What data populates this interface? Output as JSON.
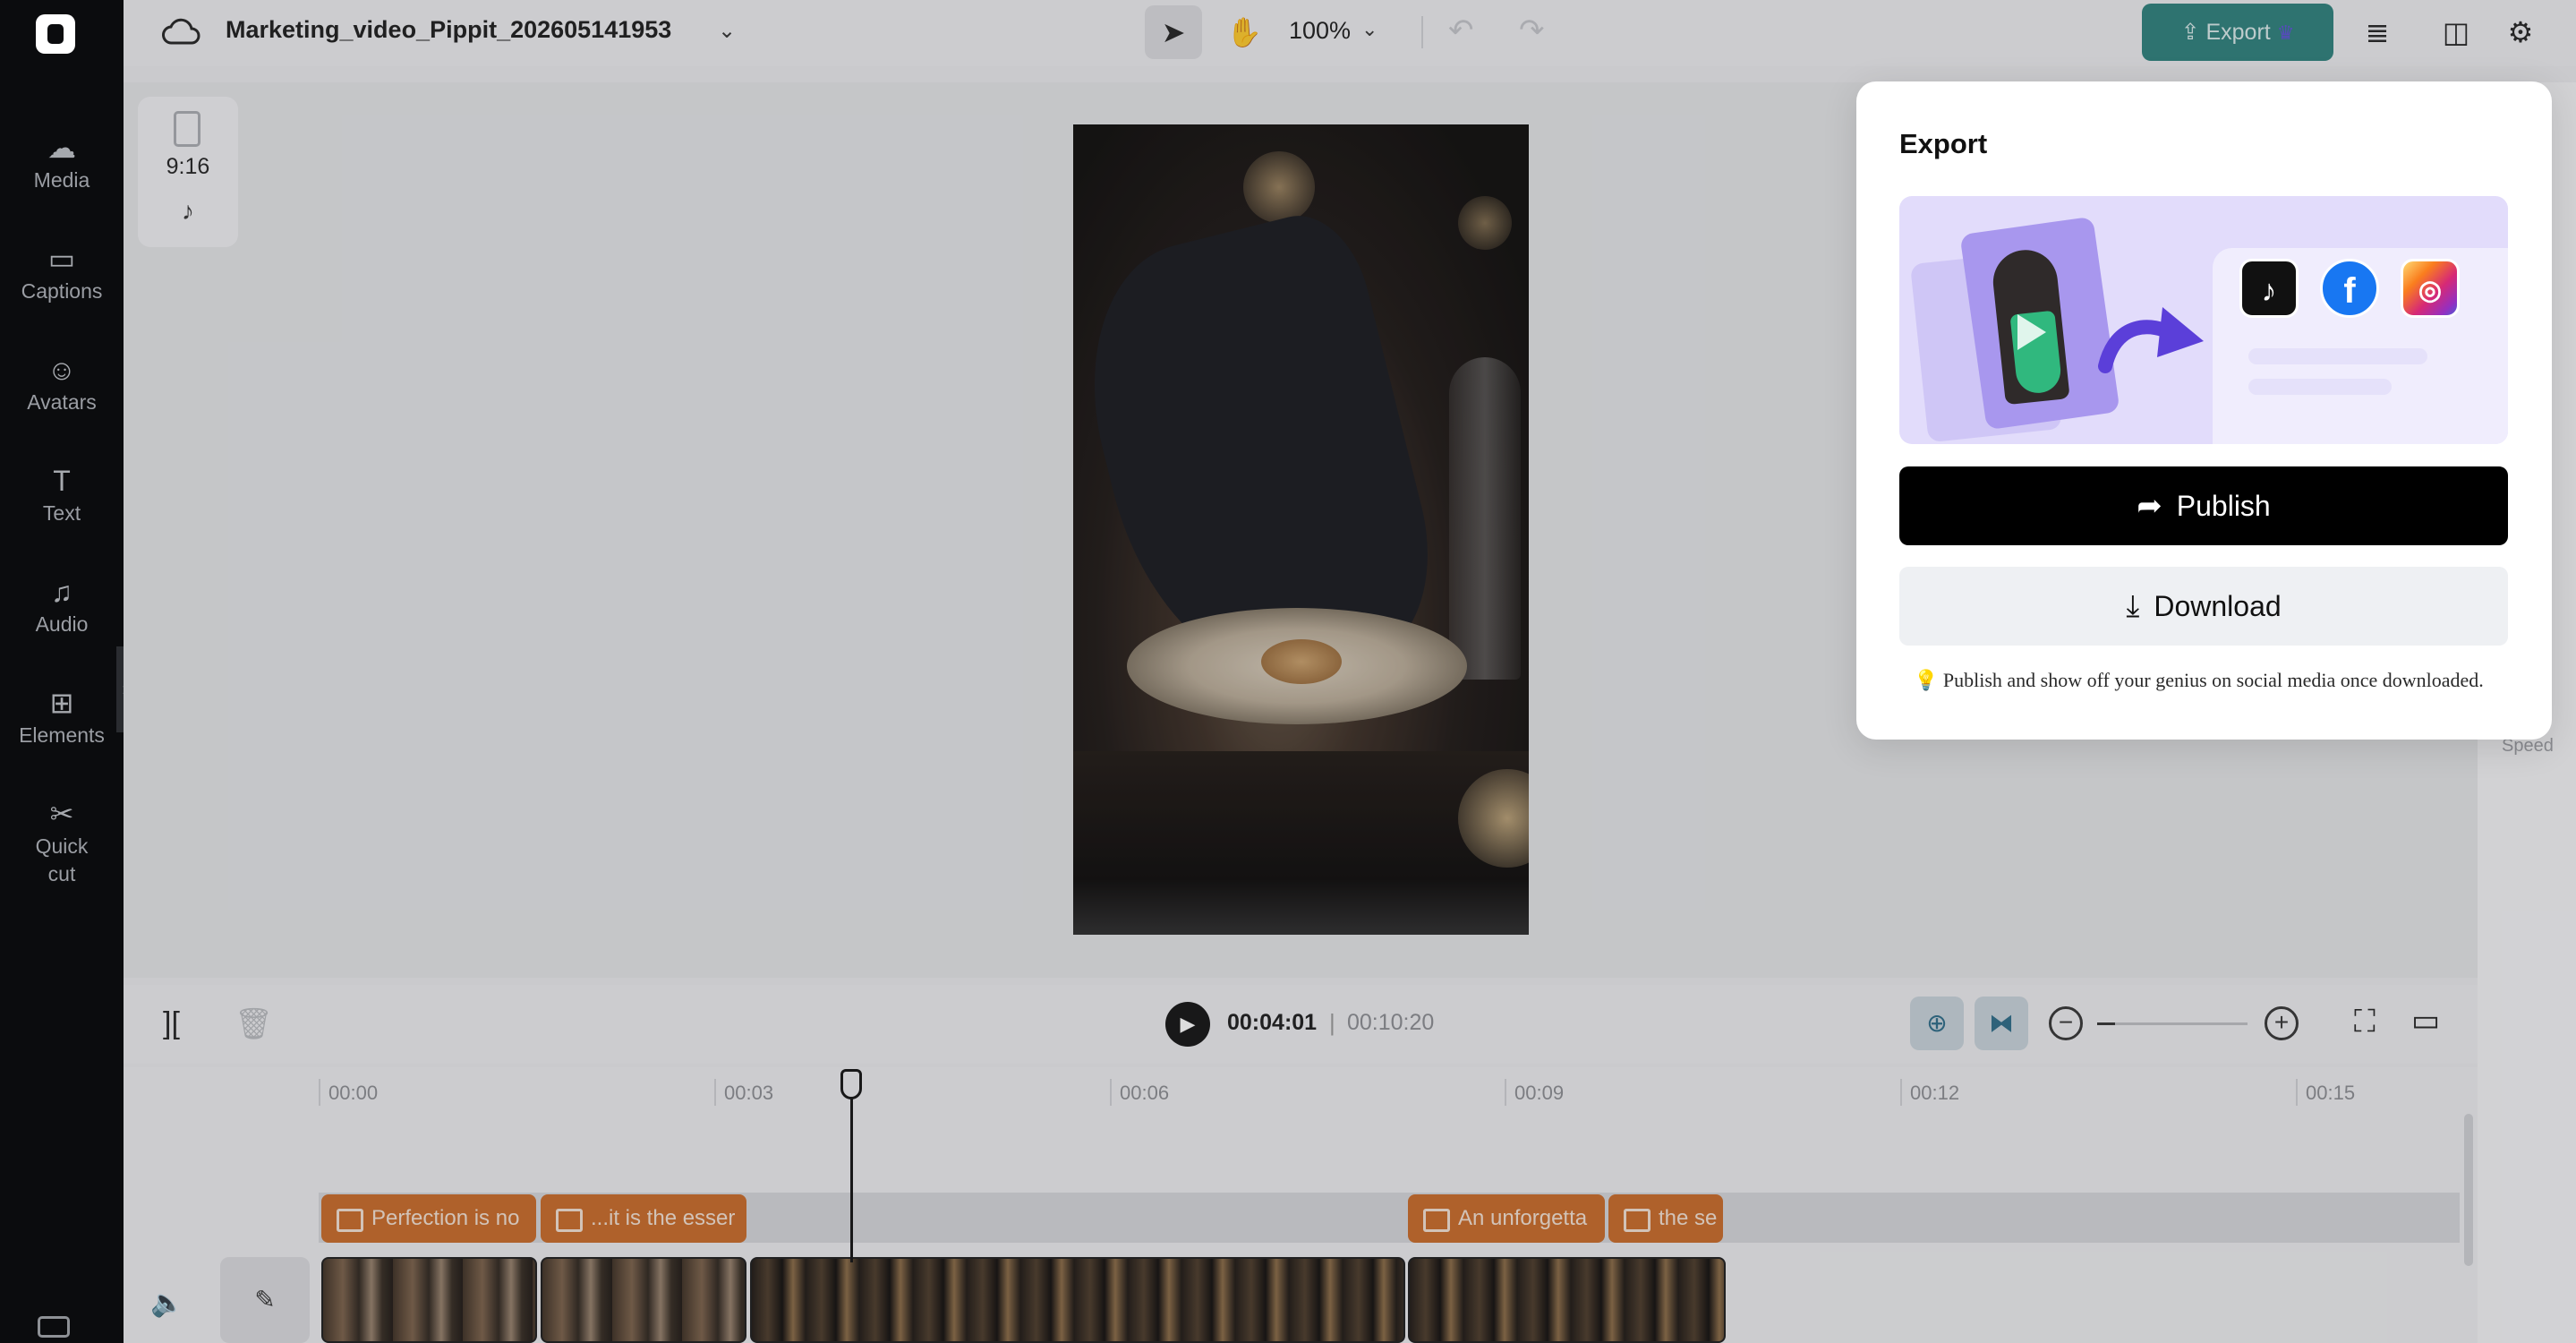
{
  "project": {
    "title": "Marketing_video_Pippit_202605141953"
  },
  "rail": {
    "items": [
      {
        "label": "Media",
        "icon": "cloud-upload-icon"
      },
      {
        "label": "Captions",
        "icon": "captions-icon"
      },
      {
        "label": "Avatars",
        "icon": "avatar-icon"
      },
      {
        "label": "Text",
        "icon": "text-icon"
      },
      {
        "label": "Audio",
        "icon": "music-note-icon"
      },
      {
        "label": "Elements",
        "icon": "elements-icon"
      },
      {
        "label": "Quick\ncut",
        "icon": "quick-cut-icon"
      }
    ]
  },
  "topbar": {
    "zoom": "100%",
    "export_label": "Export"
  },
  "ratio": {
    "label": "9:16"
  },
  "playback": {
    "current_time": "00:04:01",
    "separator": "|",
    "total_time": "00:10:20",
    "zoom_level": 0.12
  },
  "timeline": {
    "ticks": [
      "00:00",
      "00:03",
      "00:06",
      "00:09",
      "00:12",
      "00:15"
    ],
    "captions": [
      "Perfection is no",
      "...it is the esser",
      "An unforgetta",
      "the se"
    ]
  },
  "right_panel": {
    "speed_label": "Speed"
  },
  "export_modal": {
    "title": "Export",
    "publish_label": "Publish",
    "download_label": "Download",
    "tip": "💡 Publish and show off your genius on social media once downloaded."
  },
  "colors": {
    "accent_export": "#2b7f7a",
    "caption_chip": "#c96a26",
    "modal_hero": "#e2dcfb"
  }
}
